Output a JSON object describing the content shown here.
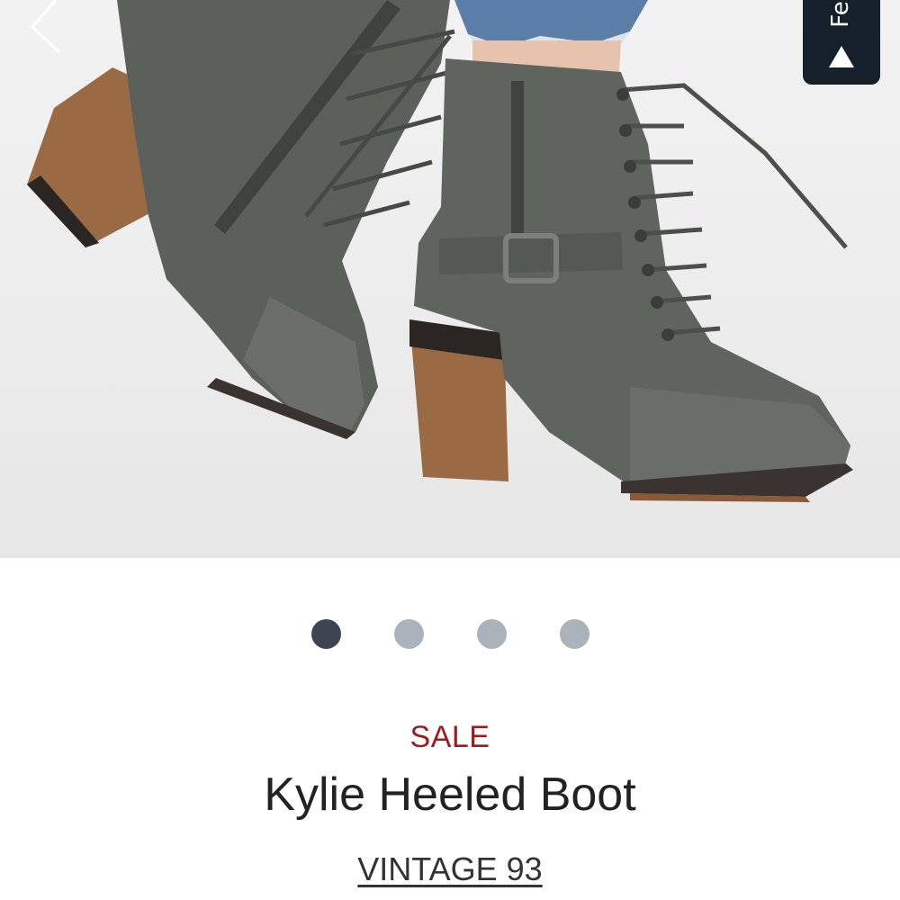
{
  "gallery": {
    "image_alt": "Kylie Heeled Boot product photo",
    "prev_icon": "chevron-left-icon",
    "dots": [
      {
        "active": true
      },
      {
        "active": false
      },
      {
        "active": false
      },
      {
        "active": false
      }
    ]
  },
  "feedback": {
    "label": "Fe",
    "icon": "triangle-up-icon"
  },
  "product": {
    "badge": "SALE",
    "name": "Kylie Heeled Boot",
    "brand": "VINTAGE 93"
  },
  "colors": {
    "sale_red": "#9b1b1f",
    "dot_active": "#3d4550",
    "dot_inactive": "#aab2bb",
    "feedback_bg": "#15202b"
  }
}
